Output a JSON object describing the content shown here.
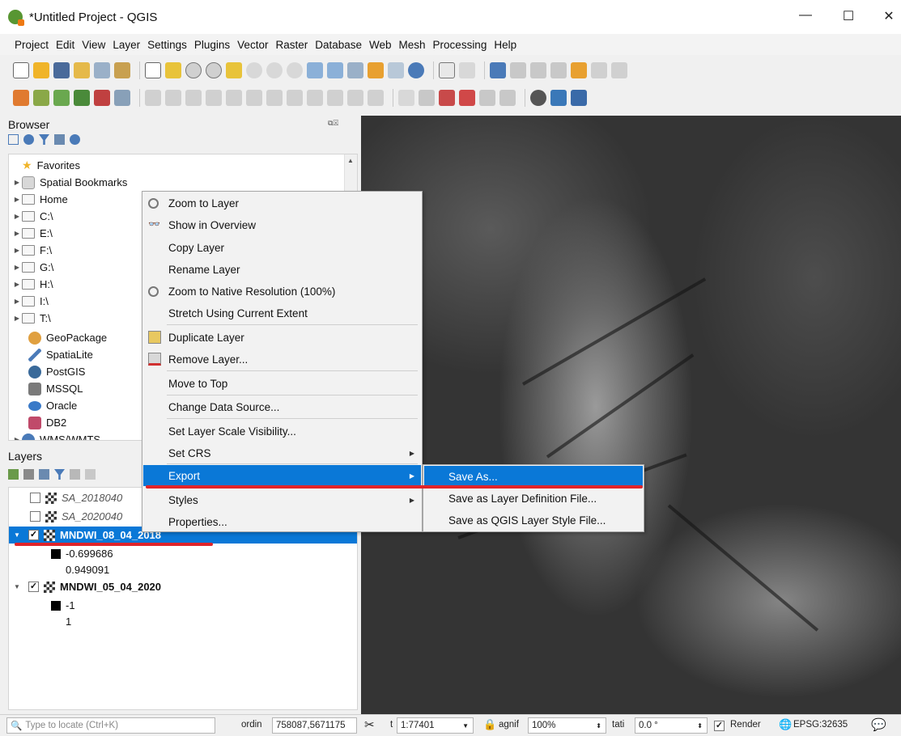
{
  "window": {
    "title": "*Untitled Project - QGIS",
    "minimize": "—",
    "maximize": "☐",
    "close": "✕"
  },
  "menubar": [
    "Project",
    "Edit",
    "View",
    "Layer",
    "Settings",
    "Plugins",
    "Vector",
    "Raster",
    "Database",
    "Web",
    "Mesh",
    "Processing",
    "Help"
  ],
  "browser": {
    "title": "Browser",
    "items": [
      {
        "label": "Favorites",
        "icon": "star-icon",
        "arrow": ""
      },
      {
        "label": "Spatial Bookmarks",
        "icon": "bookmark-icon",
        "arrow": "▶"
      },
      {
        "label": "Home",
        "icon": "home-folder-icon",
        "arrow": "▶"
      },
      {
        "label": "C:\\",
        "icon": "folder-icon",
        "arrow": "▶"
      },
      {
        "label": "E:\\",
        "icon": "folder-icon",
        "arrow": "▶"
      },
      {
        "label": "F:\\",
        "icon": "folder-icon",
        "arrow": "▶"
      },
      {
        "label": "G:\\",
        "icon": "folder-icon",
        "arrow": "▶"
      },
      {
        "label": "H:\\",
        "icon": "folder-icon",
        "arrow": "▶"
      },
      {
        "label": "I:\\",
        "icon": "folder-icon",
        "arrow": "▶"
      },
      {
        "label": "T:\\",
        "icon": "folder-icon",
        "arrow": "▶"
      },
      {
        "label": "GeoPackage",
        "icon": "geopackage-icon",
        "arrow": ""
      },
      {
        "label": "SpatiaLite",
        "icon": "spatialite-icon",
        "arrow": ""
      },
      {
        "label": "PostGIS",
        "icon": "postgis-icon",
        "arrow": ""
      },
      {
        "label": "MSSQL",
        "icon": "mssql-icon",
        "arrow": ""
      },
      {
        "label": "Oracle",
        "icon": "oracle-icon",
        "arrow": ""
      },
      {
        "label": "DB2",
        "icon": "db2-icon",
        "arrow": ""
      },
      {
        "label": "WMS/WMTS",
        "icon": "wms-icon",
        "arrow": "▶"
      }
    ]
  },
  "layers": {
    "title": "Layers",
    "items": [
      {
        "label": "SA_2018040",
        "checked": "",
        "style": "italic"
      },
      {
        "label": "SA_2020040",
        "checked": "",
        "style": "italic"
      },
      {
        "label": "MNDWI_08_04_2018",
        "checked": "✓",
        "style": "bold-selected"
      },
      {
        "label": "-0.699686",
        "legend": true
      },
      {
        "label": "0.949091",
        "legend": false
      },
      {
        "label": "MNDWI_05_04_2020",
        "checked": "✓",
        "style": "bold"
      },
      {
        "label": "-1",
        "legend": true
      },
      {
        "label": "1",
        "legend": false
      }
    ]
  },
  "context_menu": {
    "items": [
      {
        "label": "Zoom to Layer",
        "icon": "zoom-layer-icon"
      },
      {
        "label": "Show in Overview",
        "icon": "overview-icon"
      },
      {
        "label": "Copy Layer",
        "icon": ""
      },
      {
        "label": "Rename Layer",
        "icon": ""
      },
      {
        "label": "Zoom to Native Resolution (100%)",
        "icon": "native-resolution-icon"
      },
      {
        "label": "Stretch Using Current Extent",
        "icon": ""
      },
      {
        "label": "Duplicate Layer",
        "icon": "duplicate-layer-icon"
      },
      {
        "label": "Remove Layer...",
        "icon": "remove-layer-icon"
      },
      {
        "label": "Move to Top",
        "icon": ""
      },
      {
        "label": "Change Data Source...",
        "icon": ""
      },
      {
        "label": "Set Layer Scale Visibility...",
        "icon": ""
      },
      {
        "label": "Set CRS",
        "icon": ""
      },
      {
        "label": "Export",
        "icon": ""
      },
      {
        "label": "Styles",
        "icon": ""
      },
      {
        "label": "Properties...",
        "icon": ""
      }
    ],
    "submenu_arrow": "▶"
  },
  "export_submenu": {
    "items": [
      "Save As...",
      "Save as Layer Definition File...",
      "Save as QGIS Layer Style File..."
    ]
  },
  "statusbar": {
    "locate_placeholder": "Type to locate (Ctrl+K)",
    "coordinate_label": "ordin",
    "coordinate_value": "758087,5671175",
    "scale_label": "t",
    "scale_value": "1:77401",
    "magnifier_label": "agnif",
    "magnifier_value": "100%",
    "rotation_label": "tati",
    "rotation_value": "0.0 °",
    "render_label": "Render",
    "render_checked": "✓",
    "crs": "EPSG:32635"
  },
  "colors": {
    "highlight": "#0a78d7",
    "annotation": "#e0242a"
  }
}
